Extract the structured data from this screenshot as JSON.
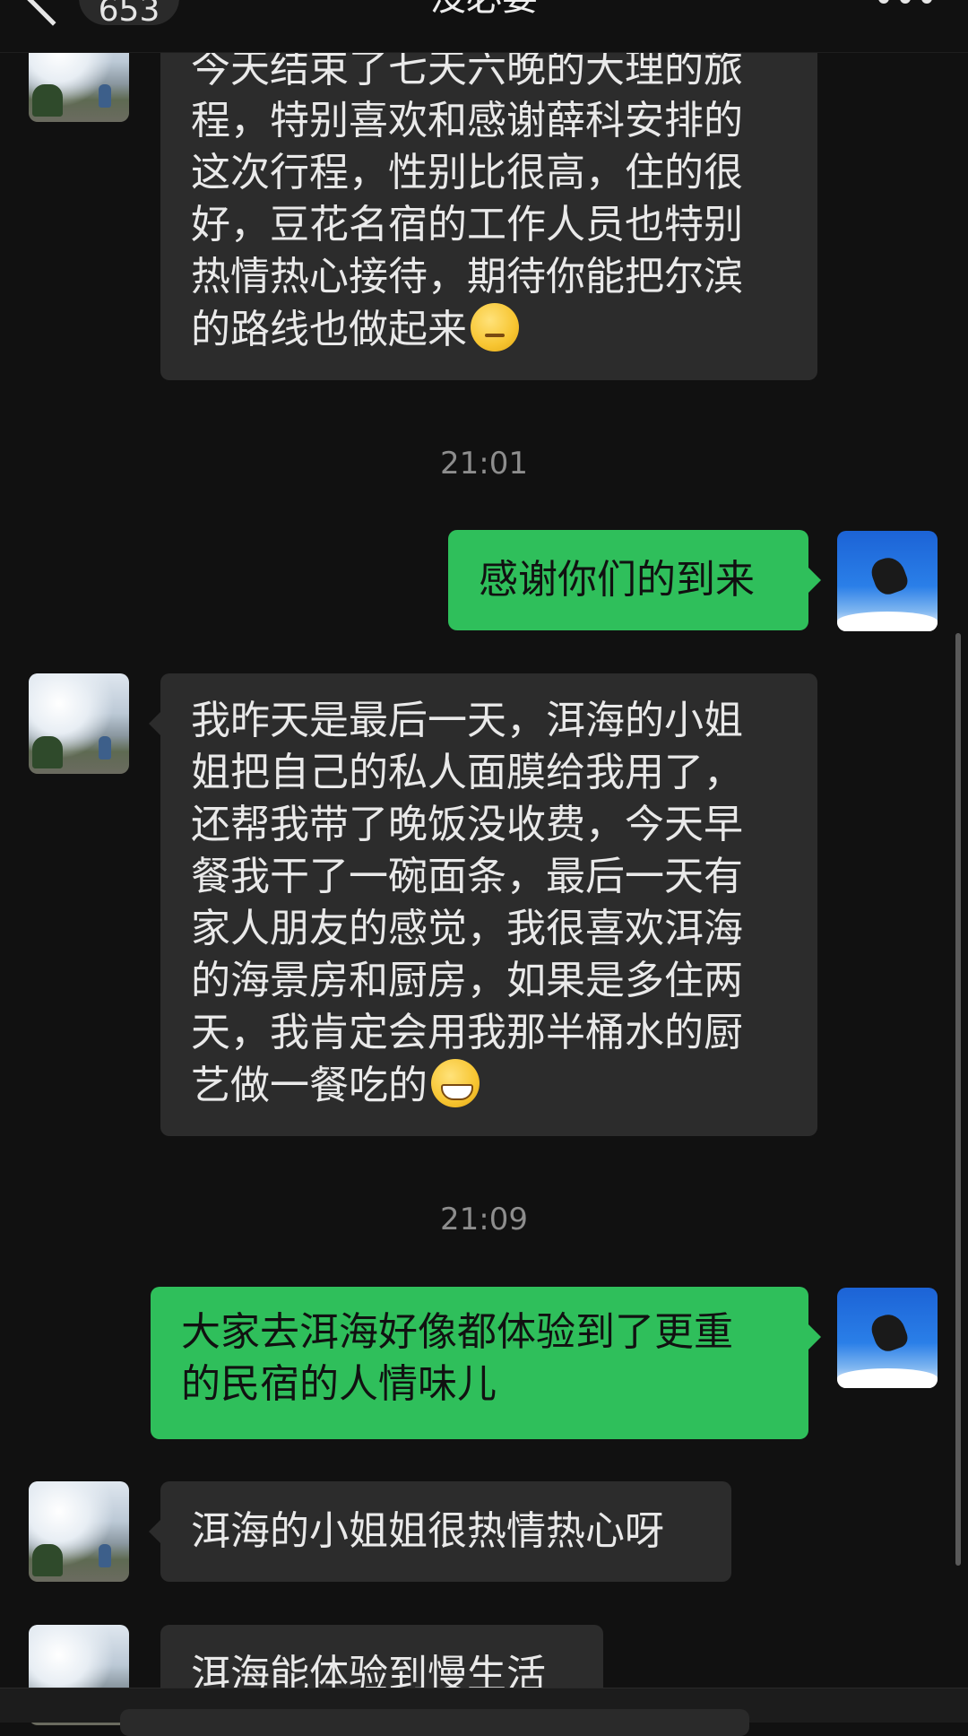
{
  "header": {
    "unread_count": "653",
    "title": "没必要"
  },
  "messages": [
    {
      "side": "in",
      "text": "今天结束了七天六晚的大理的旅\n程，特别喜欢和感谢薛科安排的\n这次行程，性别比很高，住的很\n好，豆花名宿的工作人员也特别\n热情热心接待，期待你能把尔滨\n的路线也做起来",
      "emoji": "thinking-face"
    },
    {
      "side": "out",
      "text": "感谢你们的到来"
    },
    {
      "side": "in",
      "text": "我昨天是最后一天，洱海的小姐\n姐把自己的私人面膜给我用了，\n还帮我带了晚饭没收费，今天早\n餐我干了一碗面条，最后一天有\n家人朋友的感觉，我很喜欢洱海\n的海景房和厨房，如果是多住两\n天，我肯定会用我那半桶水的厨\n艺做一餐吃的",
      "emoji": "grinning-face"
    },
    {
      "side": "out",
      "text": "大家去洱海好像都体验到了更重\n的民宿的人情味儿"
    },
    {
      "side": "in",
      "text": "洱海的小姐姐很热情热心呀"
    },
    {
      "side": "in",
      "text": "洱海能体验到慢生活"
    }
  ],
  "timestamps": [
    "21:01",
    "21:09"
  ],
  "colors": {
    "background": "#111111",
    "incoming_bubble": "#2c2c2c",
    "outgoing_bubble": "#2fbf5b",
    "timestamp_text": "#8d8d8d"
  }
}
